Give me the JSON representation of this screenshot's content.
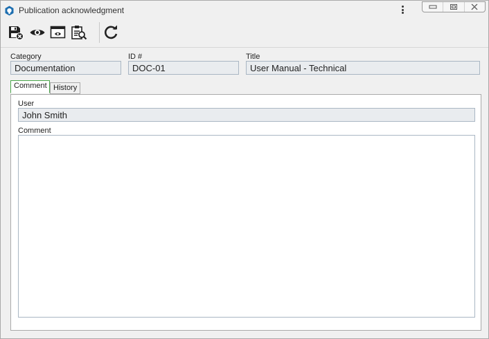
{
  "window": {
    "title": "Publication acknowledgment"
  },
  "toolbar": {
    "buttons": [
      "save-and-close-icon",
      "view-icon",
      "view-window-icon",
      "document-search-icon",
      "refresh-icon"
    ]
  },
  "form": {
    "category_label": "Category",
    "category_value": "Documentation",
    "id_label": "ID #",
    "id_value": "DOC-01",
    "title_label": "Title",
    "title_value": "User Manual - Technical"
  },
  "tabs": [
    {
      "label": "Comment",
      "active": true
    },
    {
      "label": "History",
      "active": false
    }
  ],
  "comment_tab": {
    "user_label": "User",
    "user_value": "John Smith",
    "comment_label": "Comment",
    "comment_value": ""
  },
  "colors": {
    "active_tab_border": "#4aa64a",
    "field_background": "#e9ecef"
  }
}
